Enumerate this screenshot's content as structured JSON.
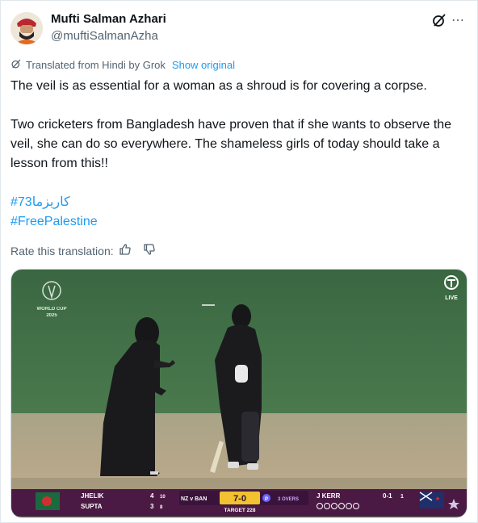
{
  "author": {
    "name": "Mufti Salman Azhari",
    "handle": "@muftiSalmanAzha"
  },
  "header_icons": [
    "grok-icon",
    "more-icon"
  ],
  "more_glyph": "⋯",
  "translation": {
    "prefix": "Translated from Hindi by Grok",
    "show_original": "Show original"
  },
  "post": {
    "line1": "The veil is as essential for a woman as a shroud is for covering a corpse.",
    "line2": "Two cricketers from Bangladesh have proven that if she wants to observe the veil, she can do so everywhere. The shameless girls of today should take a lesson from this!!",
    "hashtag1": "#کاریزما73",
    "hashtag2": "#FreePalestine"
  },
  "rate": {
    "label": "Rate this translation:"
  },
  "media": {
    "broadcaster_badge": "LIVE",
    "event_logo_text": "WORLD CUP",
    "event_logo_year": "2025",
    "scoreboard": {
      "batter1_name": "JHELIK",
      "batter1_runs": "4",
      "batter1_balls": "10",
      "batter2_name": "SUPTA",
      "batter2_runs": "3",
      "batter2_balls": "8",
      "match": "NZ v BAN",
      "score": "7-0",
      "powerplay": "P",
      "overs": "3 OVERS",
      "target": "TARGET 228",
      "bowler_name": "J KERR",
      "bowler_figures": "0-1",
      "bowler_overs": "1"
    },
    "colors": {
      "grass": "#3f6a44",
      "pitch": "#b7a58a",
      "scoreboard_bg": "#5b1b4d",
      "score_box": "#f2c230"
    }
  }
}
